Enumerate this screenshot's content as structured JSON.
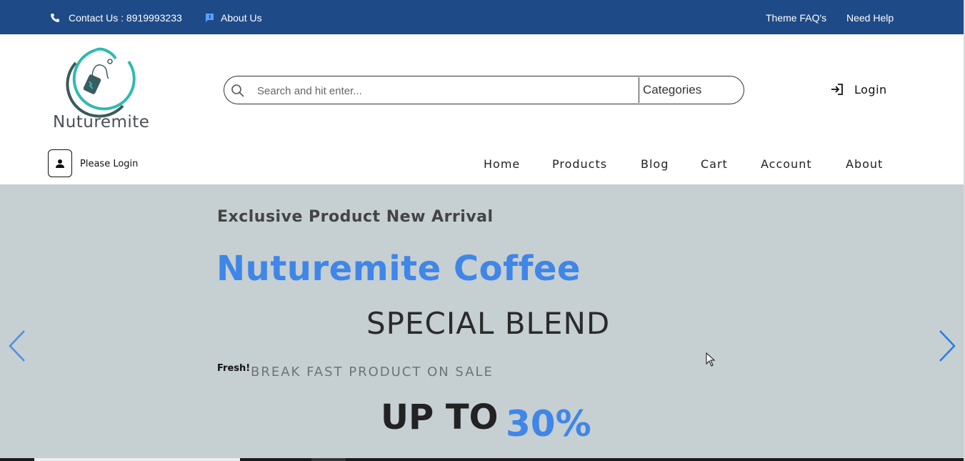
{
  "topbar": {
    "contact": "Contact Us : 8919993233",
    "about": "About Us",
    "faq": "Theme FAQ's",
    "help": "Need Help"
  },
  "brand": {
    "name": "Nuturemite"
  },
  "search": {
    "placeholder": "Search and hit enter...",
    "categories": "Categories"
  },
  "account": {
    "login": "Login",
    "please_login": "Please Login"
  },
  "nav": [
    "Home",
    "Products",
    "Blog",
    "Cart",
    "Account",
    "About"
  ],
  "hero": {
    "eyebrow": "Exclusive Product New Arrival",
    "headline": "Nuturemite Coffee",
    "blend": "SPECIAL BLEND",
    "fresh": "Fresh!",
    "sale": "BREAK FAST PRODUCT ON SALE",
    "upto": "UP TO",
    "percent": "30%"
  },
  "colors": {
    "topbar": "#1e4a87",
    "accent": "#3f86e8",
    "hero_bg": "#c6cfd2"
  }
}
